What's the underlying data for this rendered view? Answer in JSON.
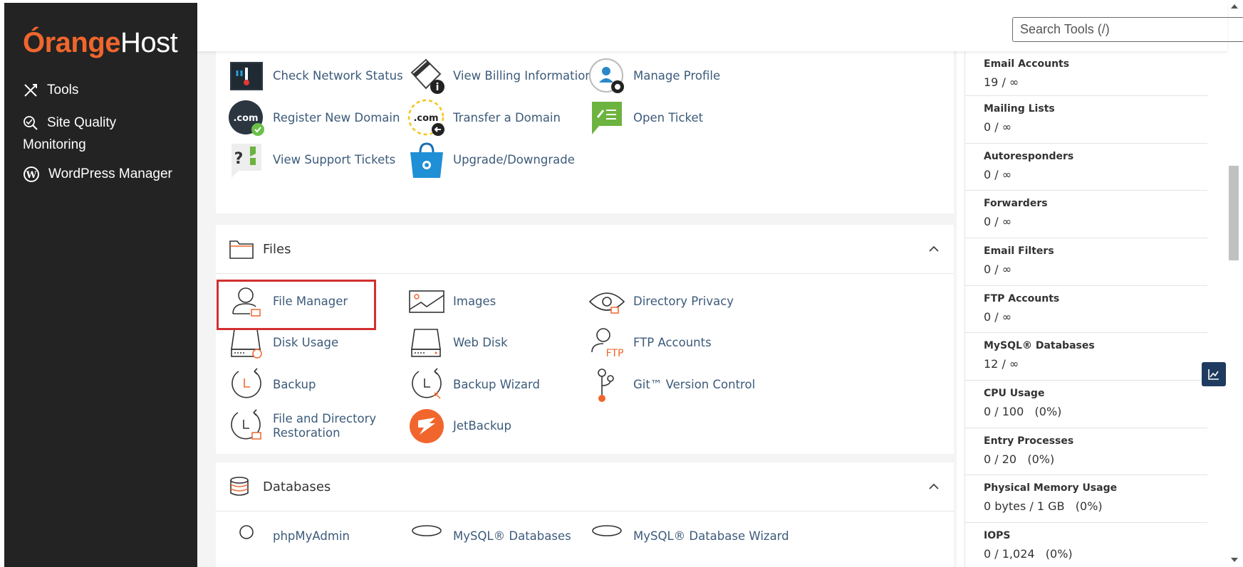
{
  "brand": {
    "logo_part1": "Órange",
    "logo_part2": "Host",
    "accent": "#f0662d"
  },
  "sidebar": {
    "items": [
      {
        "label": "Tools",
        "icon": "tools-icon"
      },
      {
        "label": "Site Quality",
        "label2": "Monitoring",
        "icon": "site-quality-icon"
      },
      {
        "label": "WordPress Manager",
        "icon": "wordpress-icon"
      }
    ]
  },
  "header": {
    "search_placeholder": "Search Tools (/)"
  },
  "general_tools": [
    {
      "label": "Check Network Status",
      "icon": "network-status-icon"
    },
    {
      "label": "View Billing Information",
      "icon": "billing-icon"
    },
    {
      "label": "Manage Profile",
      "icon": "profile-icon"
    },
    {
      "label": "Register New Domain",
      "icon": "register-domain-icon"
    },
    {
      "label": "Transfer a Domain",
      "icon": "transfer-domain-icon"
    },
    {
      "label": "Open Ticket",
      "icon": "ticket-icon"
    },
    {
      "label": "View Support Tickets",
      "icon": "support-tickets-icon"
    },
    {
      "label": "Upgrade/Downgrade",
      "icon": "upgrade-icon"
    }
  ],
  "files": {
    "title": "Files",
    "tools": [
      {
        "label": "File Manager",
        "icon": "file-manager-icon"
      },
      {
        "label": "Images",
        "icon": "images-icon"
      },
      {
        "label": "Directory Privacy",
        "icon": "directory-privacy-icon"
      },
      {
        "label": "Disk Usage",
        "icon": "disk-usage-icon"
      },
      {
        "label": "Web Disk",
        "icon": "web-disk-icon"
      },
      {
        "label": "FTP Accounts",
        "icon": "ftp-accounts-icon"
      },
      {
        "label": "Backup",
        "icon": "backup-icon"
      },
      {
        "label": "Backup Wizard",
        "icon": "backup-wizard-icon"
      },
      {
        "label": "Git™ Version Control",
        "icon": "git-icon"
      },
      {
        "label": "File and Directory",
        "label2": "Restoration",
        "icon": "restoration-icon"
      },
      {
        "label": "JetBackup",
        "icon": "jetbackup-icon"
      }
    ]
  },
  "databases": {
    "title": "Databases",
    "tools": [
      {
        "label": "phpMyAdmin"
      },
      {
        "label": "MySQL® Databases"
      },
      {
        "label": "MySQL® Database Wizard"
      }
    ]
  },
  "stats": [
    {
      "label": "Email Accounts",
      "value": "19 / ∞"
    },
    {
      "label": "Mailing Lists",
      "value": "0 / ∞"
    },
    {
      "label": "Autoresponders",
      "value": "0 / ∞"
    },
    {
      "label": "Forwarders",
      "value": "0 / ∞"
    },
    {
      "label": "Email Filters",
      "value": "0 / ∞"
    },
    {
      "label": "FTP Accounts",
      "value": "0 / ∞"
    },
    {
      "label": "MySQL® Databases",
      "value": "12 / ∞"
    },
    {
      "label": "CPU Usage",
      "value": "0 / 100   (0%)"
    },
    {
      "label": "Entry Processes",
      "value": "0 / 20   (0%)"
    },
    {
      "label": "Physical Memory Usage",
      "value": "0 bytes / 1 GB   (0%)"
    },
    {
      "label": "IOPS",
      "value": "0 / 1,024   (0%)"
    }
  ]
}
